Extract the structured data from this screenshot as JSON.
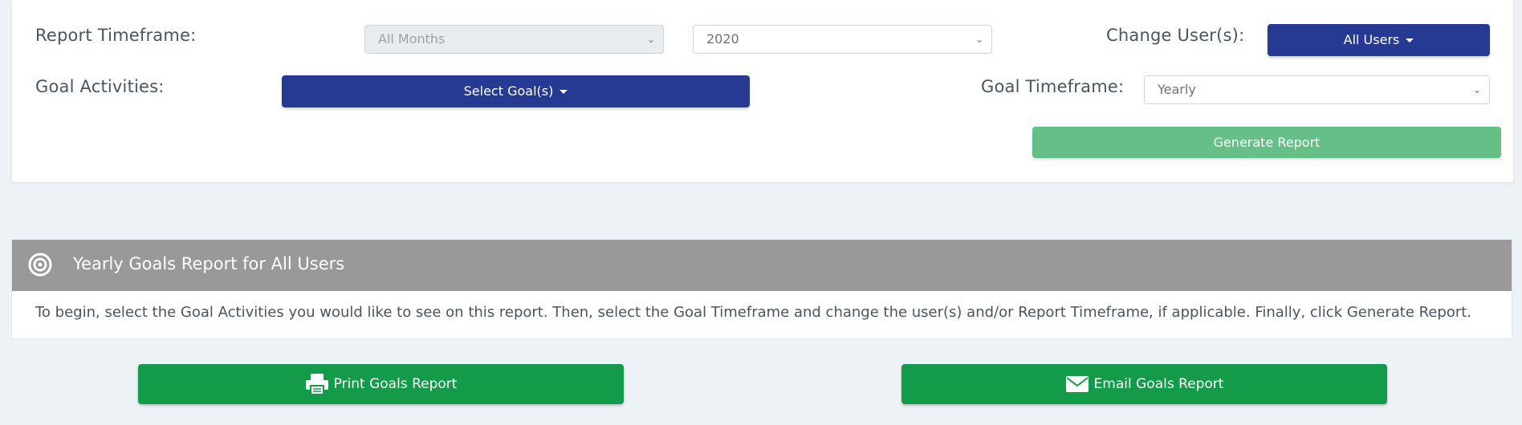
{
  "filters": {
    "report_timeframe_label": "Report Timeframe:",
    "month_select_value": "All Months",
    "year_select_value": "2020",
    "change_users_label": "Change User(s):",
    "users_button_label": "All Users",
    "goal_activities_label": "Goal Activities:",
    "select_goals_button_label": "Select Goal(s)",
    "goal_timeframe_label": "Goal Timeframe:",
    "goal_timeframe_value": "Yearly",
    "generate_button_label": "Generate Report"
  },
  "report": {
    "icon": "target-icon",
    "title": "Yearly Goals Report for All Users",
    "instructions": "To begin, select the Goal Activities you would like to see on this report. Then, select the Goal Timeframe and change the user(s) and/or Report Timeframe, if applicable. Finally, click Generate Report."
  },
  "actions": {
    "print_label": "Print Goals Report",
    "print_icon": "printer-icon",
    "email_label": "Email Goals Report",
    "email_icon": "envelope-icon"
  },
  "colors": {
    "primary_blue": "#263a93",
    "generate_green_disabled": "#66bf87",
    "action_green": "#149b4a",
    "header_gray": "#999999",
    "page_bg": "#edf2f6"
  }
}
